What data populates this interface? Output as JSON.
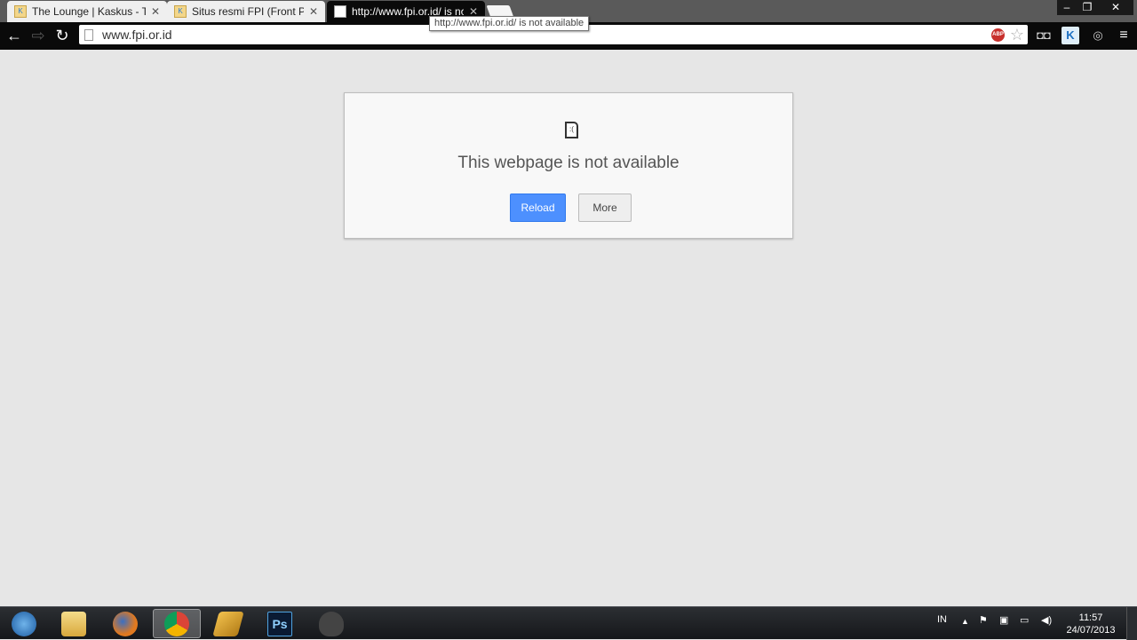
{
  "browser": {
    "tabs": [
      {
        "title": "The Lounge | Kaskus - The",
        "icon": "kaskus-favicon"
      },
      {
        "title": "Situs resmi FPI (Front Pem",
        "icon": "kaskus-favicon"
      },
      {
        "title": "http://www.fpi.or.id/ is not available",
        "icon": "page-icon",
        "active": true
      }
    ],
    "tooltip": "http://www.fpi.or.id/ is not available",
    "omnibox": {
      "url": "www.fpi.or.id"
    },
    "window_controls": {
      "minimize": "–",
      "restore": "❐",
      "close": "✕"
    },
    "extensions": [
      "adblock-plus",
      "bookmark-star",
      "glasses-extension",
      "kaskus-extension",
      "globe-extension",
      "menu"
    ],
    "abp_label": "ABP"
  },
  "error_page": {
    "message": "This webpage is not available",
    "reload_label": "Reload",
    "more_label": "More"
  },
  "taskbar": {
    "apps": [
      "start",
      "windows-explorer",
      "firefox",
      "chrome",
      "winamp",
      "photoshop",
      "inkscape"
    ],
    "ps_label": "Ps",
    "language": "IN",
    "time": "11:57",
    "date": "24/07/2013"
  },
  "colors": {
    "reload_button": "#4d90fe",
    "page_bg": "#e6e6e6"
  }
}
